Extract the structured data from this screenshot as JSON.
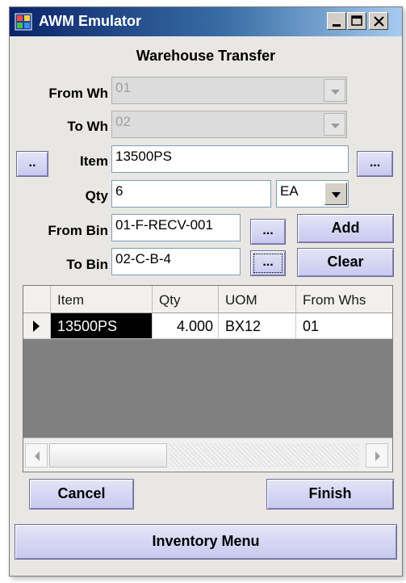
{
  "window": {
    "title": "AWM Emulator"
  },
  "form": {
    "heading": "Warehouse Transfer",
    "from_wh": {
      "label": "From Wh",
      "value": "01"
    },
    "to_wh": {
      "label": "To Wh",
      "value": "02"
    },
    "item": {
      "label": "Item",
      "value": "13500PS",
      "lookup_left": "..",
      "lookup_right": "..."
    },
    "qty": {
      "label": "Qty",
      "value": "6",
      "uom": "EA"
    },
    "from_bin": {
      "label": "From Bin",
      "value": "01-F-RECV-001",
      "lookup": "..."
    },
    "to_bin": {
      "label": "To Bin",
      "value": "02-C-B-4",
      "lookup": "..."
    },
    "add_label": "Add",
    "clear_label": "Clear"
  },
  "grid": {
    "columns": [
      "Item",
      "Qty",
      "UOM",
      "From Whs"
    ],
    "rows": [
      {
        "item": "13500PS",
        "qty": "4.000",
        "uom": "BX12",
        "from_whs": "01"
      }
    ]
  },
  "footer": {
    "cancel_label": "Cancel",
    "finish_label": "Finish",
    "inventory_menu_label": "Inventory Menu"
  },
  "colors": {
    "title_bar": "#0a246a",
    "button_face": "#c8c8ef",
    "selected_cell": "#000000"
  },
  "icons": [
    "app-icon",
    "minimize-icon",
    "maximize-icon",
    "close-icon",
    "dropdown-arrow-icon",
    "row-pointer-icon",
    "scroll-left-icon",
    "scroll-right-icon"
  ]
}
